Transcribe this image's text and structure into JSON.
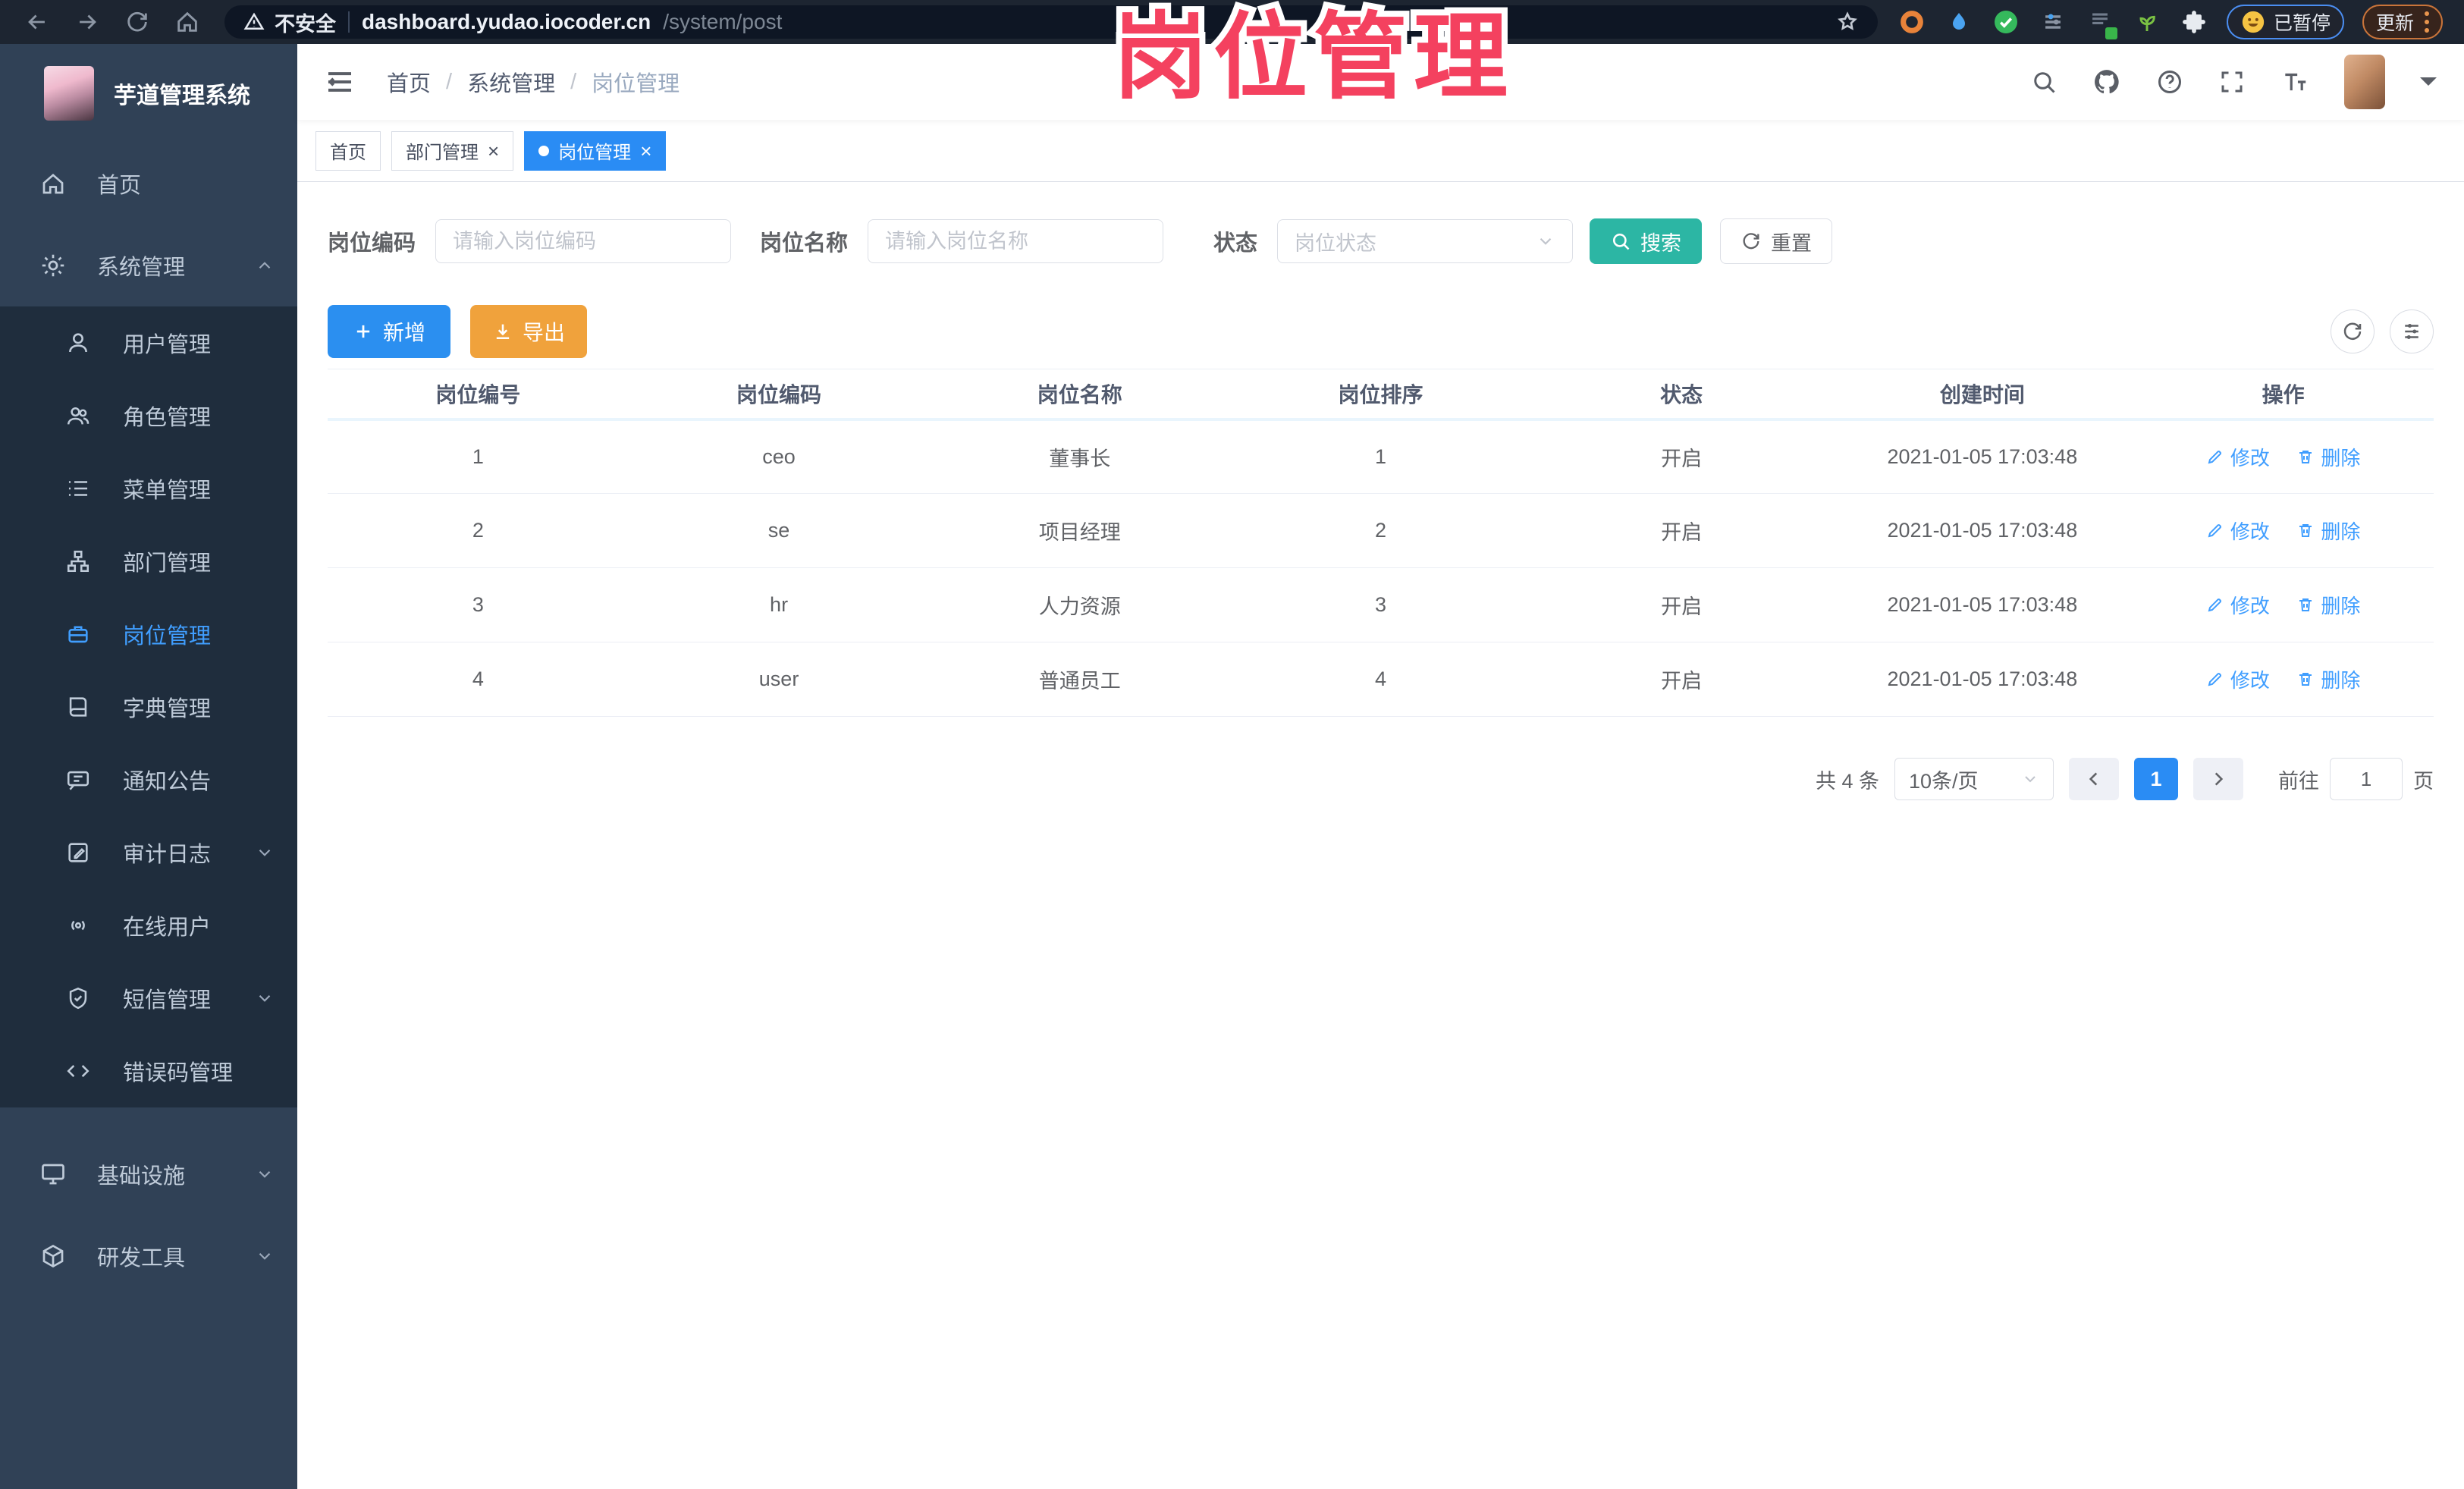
{
  "browser": {
    "security_label": "不安全",
    "url_host": "dashboard.yudao.iocoder.cn",
    "url_path": "/system/post",
    "paused_label": "已暂停",
    "update_label": "更新"
  },
  "annotation": {
    "title": "岗位管理",
    "color": "#f4415f"
  },
  "sidebar": {
    "app_title": "芋道管理系统",
    "home": "首页",
    "system": "系统管理",
    "submenu": [
      "用户管理",
      "角色管理",
      "菜单管理",
      "部门管理",
      "岗位管理",
      "字典管理",
      "通知公告",
      "审计日志",
      "在线用户",
      "短信管理",
      "错误码管理"
    ],
    "infra": "基础设施",
    "devtools": "研发工具"
  },
  "header": {
    "breadcrumb": [
      "首页",
      "系统管理",
      "岗位管理"
    ]
  },
  "tabs": [
    {
      "label": "首页"
    },
    {
      "label": "部门管理"
    },
    {
      "label": "岗位管理"
    }
  ],
  "filters": {
    "post_code_label": "岗位编码",
    "post_code_placeholder": "请输入岗位编码",
    "post_name_label": "岗位名称",
    "post_name_placeholder": "请输入岗位名称",
    "status_label": "状态",
    "status_placeholder": "岗位状态",
    "search_label": "搜索",
    "reset_label": "重置"
  },
  "toolbar": {
    "add_label": "新增",
    "export_label": "导出"
  },
  "table": {
    "headers": [
      "岗位编号",
      "岗位编码",
      "岗位名称",
      "岗位排序",
      "状态",
      "创建时间",
      "操作"
    ],
    "rows": [
      {
        "id": "1",
        "code": "ceo",
        "name": "董事长",
        "sort": "1",
        "status": "开启",
        "created": "2021-01-05 17:03:48"
      },
      {
        "id": "2",
        "code": "se",
        "name": "项目经理",
        "sort": "2",
        "status": "开启",
        "created": "2021-01-05 17:03:48"
      },
      {
        "id": "3",
        "code": "hr",
        "name": "人力资源",
        "sort": "3",
        "status": "开启",
        "created": "2021-01-05 17:03:48"
      },
      {
        "id": "4",
        "code": "user",
        "name": "普通员工",
        "sort": "4",
        "status": "开启",
        "created": "2021-01-05 17:03:48"
      }
    ],
    "edit_label": "修改",
    "delete_label": "删除"
  },
  "pagination": {
    "total": "共 4 条",
    "page_size": "10条/页",
    "current_page": "1",
    "goto_label": "前往",
    "goto_value": "1",
    "unit_label": "页"
  },
  "colors": {
    "accent_blue": "#2a8cf4",
    "teal": "#2cb6a4",
    "orange": "#f0a23c",
    "annotation_pink": "#f4415f",
    "sidebar_bg": "#304156",
    "submenu_bg": "#1f2d3d"
  }
}
